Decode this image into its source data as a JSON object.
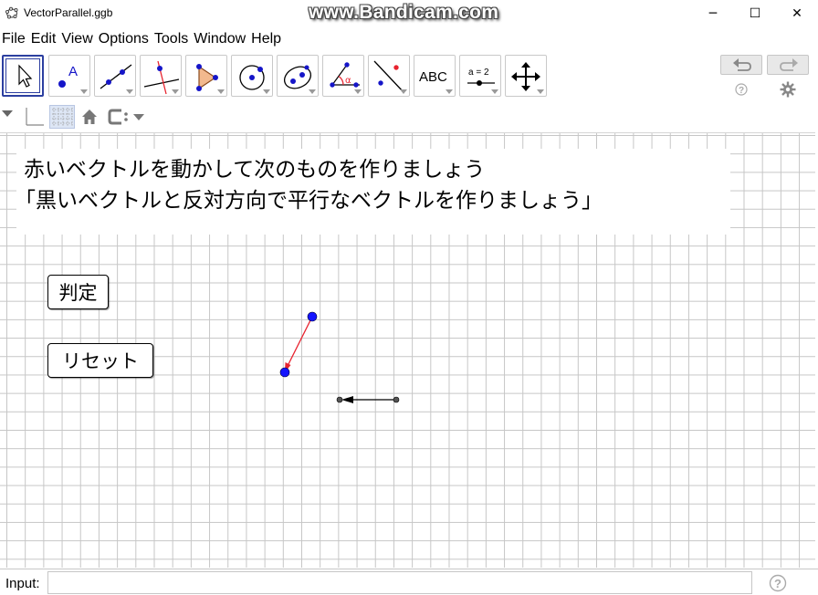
{
  "window": {
    "title": "VectorParallel.ggb",
    "watermark": "www.Bandicam.com",
    "minimize_glyph": "─",
    "maximize_glyph": "☐",
    "close_glyph": "✕"
  },
  "menu": [
    "File",
    "Edit",
    "View",
    "Options",
    "Tools",
    "Window",
    "Help"
  ],
  "toolbar": {
    "tools": [
      {
        "name": "move-tool",
        "icon": "arrow-cursor-icon"
      },
      {
        "name": "point-tool",
        "icon": "point-icon",
        "label": "A"
      },
      {
        "name": "line-tool",
        "icon": "line-through-points-icon"
      },
      {
        "name": "perpendicular-line-tool",
        "icon": "perpendicular-line-icon"
      },
      {
        "name": "polygon-tool",
        "icon": "polygon-icon"
      },
      {
        "name": "circle-tool",
        "icon": "circle-center-point-icon"
      },
      {
        "name": "ellipse-tool",
        "icon": "ellipse-icon"
      },
      {
        "name": "angle-tool",
        "icon": "angle-icon",
        "label": "α"
      },
      {
        "name": "reflect-tool",
        "icon": "reflect-about-line-icon"
      },
      {
        "name": "text-tool",
        "icon": "text-icon",
        "label": "ABC"
      },
      {
        "name": "slider-tool",
        "icon": "slider-icon",
        "label": "a = 2"
      },
      {
        "name": "move-graphics-view-tool",
        "icon": "move-view-icon"
      }
    ],
    "selected_tool": "move-tool",
    "undo_icon": "undo-icon",
    "redo_icon": "redo-icon"
  },
  "stylebar": {
    "icons": [
      "stylebar-toggle-icon",
      "axes-toggle-icon",
      "grid-toggle-icon",
      "home-icon",
      "point-capture-icon",
      "dropdown-arrow-icon"
    ]
  },
  "graphics": {
    "instructions": [
      "赤いベクトルを動かして次のものを作りましょう",
      "「黒いベクトルと反対方向で平行なベクトルを作りましょう」"
    ],
    "check_button": "判定",
    "reset_button": "リセット",
    "colors": {
      "red_vector": "#e8232f",
      "black_vector": "#000000",
      "point_fill": "#0000ff",
      "grid": "#c6c6c6"
    }
  },
  "inputbar": {
    "label": "Input:",
    "value": ""
  }
}
